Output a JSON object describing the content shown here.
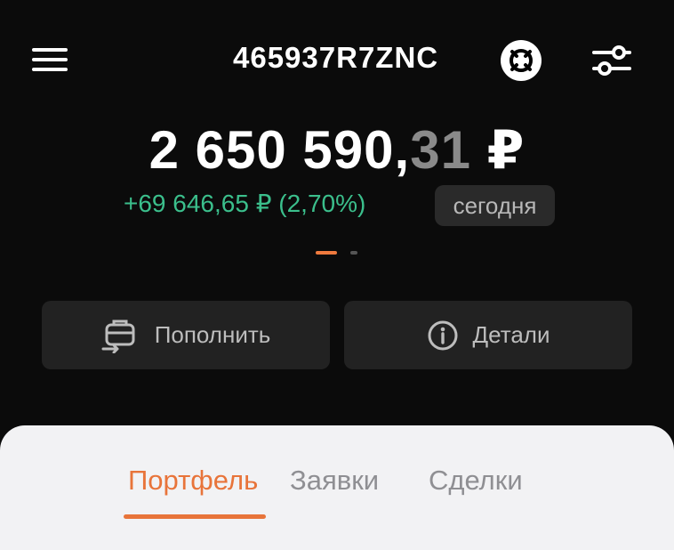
{
  "header": {
    "account_id": "465937R7ZNC",
    "menu_icon": "hamburger-menu-icon",
    "logo_icon": "broker-logo-icon",
    "filter_icon": "filter-sliders-icon"
  },
  "balance": {
    "integer": "2 650 590,",
    "cents": "31",
    "currency": " ₽",
    "change": "+69 646,65 ₽ (2,70%)",
    "period": "сегодня",
    "colors": {
      "positive": "#3bbf8c",
      "cents": "#8a8a8a"
    }
  },
  "pager": {
    "pages": 2,
    "active": 1
  },
  "actions": {
    "topup_label": "Пополнить",
    "topup_icon": "wallet-transfer-icon",
    "details_label": "Детали",
    "details_icon": "info-circle-icon"
  },
  "tabs": {
    "items": [
      {
        "label": "Портфель",
        "active": true
      },
      {
        "label": "Заявки",
        "active": false
      },
      {
        "label": "Сделки",
        "active": false
      }
    ],
    "accent": "#e8743a"
  }
}
